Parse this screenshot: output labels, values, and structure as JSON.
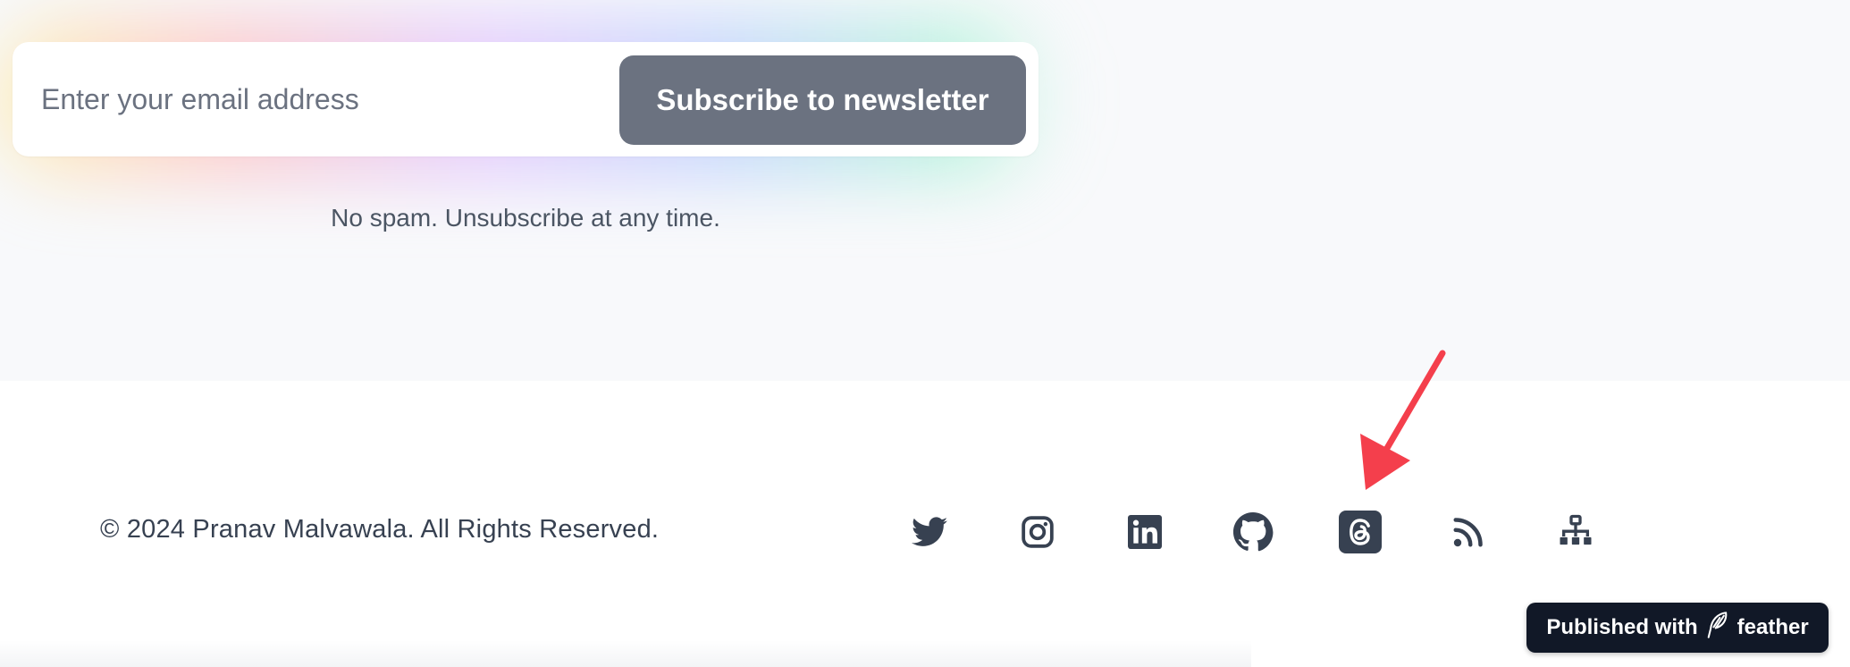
{
  "newsletter": {
    "email_placeholder": "Enter your email address",
    "subscribe_label": "Subscribe to newsletter",
    "disclaimer": "No spam. Unsubscribe at any time."
  },
  "footer": {
    "copyright": "© 2024 Pranav Malvawala. All Rights Reserved.",
    "social_links": [
      {
        "name": "twitter",
        "icon": "twitter-icon"
      },
      {
        "name": "instagram",
        "icon": "instagram-icon"
      },
      {
        "name": "linkedin",
        "icon": "linkedin-icon"
      },
      {
        "name": "github",
        "icon": "github-icon"
      },
      {
        "name": "threads",
        "icon": "threads-icon"
      },
      {
        "name": "rss",
        "icon": "rss-icon"
      },
      {
        "name": "sitemap",
        "icon": "sitemap-icon"
      }
    ]
  },
  "badge": {
    "prefix": "Published with",
    "brand": "feather",
    "icon": "feather-icon"
  },
  "colors": {
    "button_bg": "#6b7280",
    "icon_color": "#374151",
    "badge_bg": "#111827",
    "arrow": "#f43f4c"
  }
}
